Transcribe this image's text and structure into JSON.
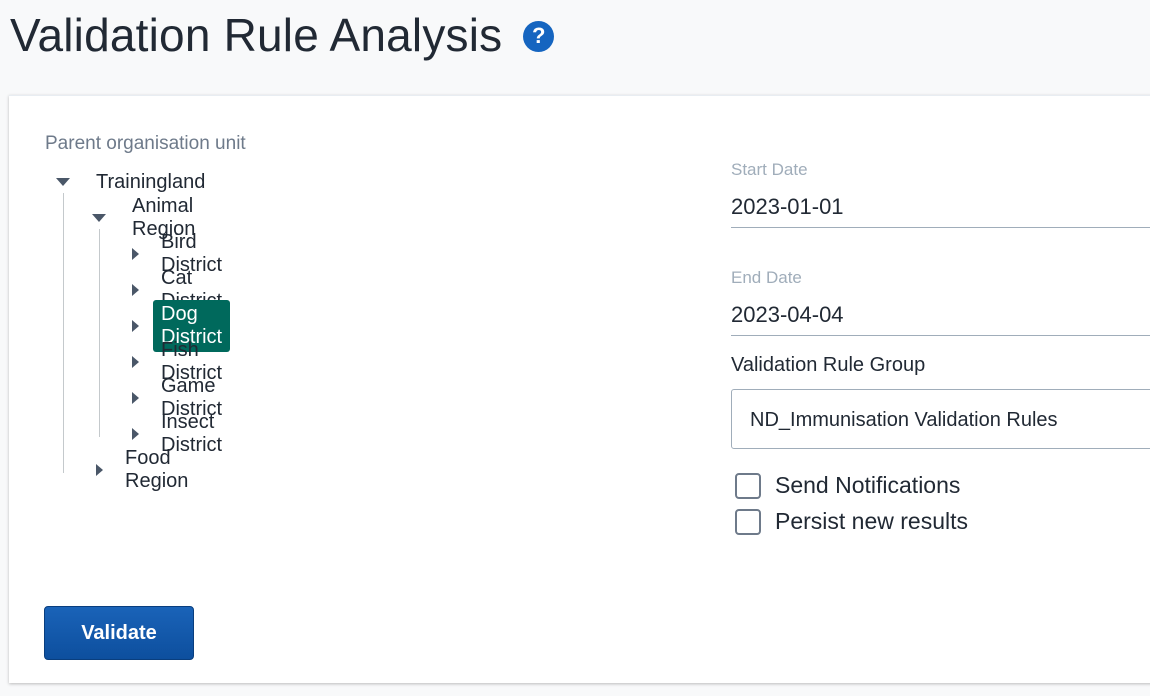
{
  "header": {
    "title": "Validation Rule Analysis",
    "help_icon": "question-circle-icon",
    "help_glyph": "?"
  },
  "org_unit": {
    "label": "Parent organisation unit",
    "tree": {
      "root": "Trainingland",
      "region_1": "Animal Region",
      "districts": [
        "Bird District",
        "Cat District",
        "Dog District",
        "Fish District",
        "Game District",
        "Insect District"
      ],
      "region_2": "Food Region",
      "selected": "Dog District"
    }
  },
  "form": {
    "start_date_label": "Start Date",
    "start_date_value": "2023-01-01",
    "end_date_label": "End Date",
    "end_date_value": "2023-04-04",
    "group_label": "Validation Rule Group",
    "group_value": "ND_Immunisation Validation Rules",
    "send_notifications_label": "Send Notifications",
    "persist_results_label": "Persist new results",
    "validate_label": "Validate"
  },
  "colors": {
    "accent": "#1565c0",
    "selected": "#00695c"
  }
}
